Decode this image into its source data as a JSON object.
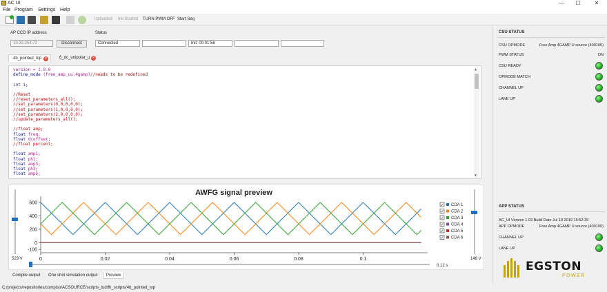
{
  "window": {
    "title": "AC UI",
    "minimize": "—",
    "maximize": "☐",
    "close": "✕"
  },
  "menu": [
    "File",
    "Program",
    "Settings",
    "Help"
  ],
  "toolbar": {
    "uploaded": "Uploaded",
    "init_started": "Init Started",
    "turn_pwm_off": "TURN PWM OFF",
    "start_seq": "Start Seq"
  },
  "ccd": {
    "label": "AP CCD IP address",
    "ip": "10.32.254.72",
    "disconnect": "Disconnect"
  },
  "status": {
    "label": "Status",
    "fields": [
      "Connected",
      "",
      "Init: 00:01:58",
      "",
      ""
    ]
  },
  "tabs": [
    "4b_pointed_top",
    "6_dc_unipolar_u"
  ],
  "code": [
    [
      {
        "t": "version = 1.0.0",
        "c": "id"
      }
    ],
    [
      {
        "t": "define_mode ",
        "c": "plain"
      },
      {
        "t": "(free_amp_uu.4gamp)",
        "c": "id"
      },
      {
        "t": "//needs to be redefined",
        "c": "cm"
      }
    ],
    [],
    [
      {
        "t": "int i;",
        "c": "plain"
      }
    ],
    [],
    [
      {
        "t": "//Reset",
        "c": "cm"
      }
    ],
    [
      {
        "t": "//reset_parameters_all();",
        "c": "cm"
      }
    ],
    [
      {
        "t": "//set_parameters(0,0,0,0,0);",
        "c": "cm"
      }
    ],
    [
      {
        "t": "//set_parameters(1,0,0,0,0);",
        "c": "cm"
      }
    ],
    [
      {
        "t": "//set_parameters(2,0,0,0,0);",
        "c": "cm"
      }
    ],
    [
      {
        "t": "//update_parameters_all();",
        "c": "cm"
      }
    ],
    [],
    [
      {
        "t": "//float amp;",
        "c": "cm"
      }
    ],
    [
      {
        "t": "float ",
        "c": "plain"
      },
      {
        "t": "freq;",
        "c": "id"
      }
    ],
    [
      {
        "t": "float ",
        "c": "plain"
      },
      {
        "t": "dcoffset;",
        "c": "id"
      }
    ],
    [
      {
        "t": "//float percent;",
        "c": "cm"
      }
    ],
    [],
    [
      {
        "t": "float ",
        "c": "plain"
      },
      {
        "t": "amp1;",
        "c": "id"
      }
    ],
    [
      {
        "t": "float ",
        "c": "plain"
      },
      {
        "t": "ph1;",
        "c": "id"
      }
    ],
    [
      {
        "t": "float ",
        "c": "plain"
      },
      {
        "t": "amp3;",
        "c": "id"
      }
    ],
    [
      {
        "t": "float ",
        "c": "plain"
      },
      {
        "t": "ph3;",
        "c": "id"
      }
    ],
    [
      {
        "t": "float ",
        "c": "plain"
      },
      {
        "t": "amp5;",
        "c": "id"
      }
    ]
  ],
  "chart_data": {
    "type": "line",
    "title": "AWFG signal preview",
    "xlabel": "",
    "ylabel": "",
    "xlim": [
      0,
      0.12
    ],
    "ylim": [
      -150,
      650
    ],
    "x_ticks": [
      "0",
      "0.02",
      "0.04",
      "0.06",
      "0.08",
      "0.1"
    ],
    "x_tick_values": [
      0,
      0.02,
      0.04,
      0.06,
      0.08,
      0.1
    ],
    "y_ticks": [
      "600",
      "400",
      "200",
      "0",
      "-100"
    ],
    "y_tick_values": [
      600,
      400,
      200,
      0,
      -100
    ],
    "grid": false,
    "legend_position": "right",
    "series": [
      {
        "name": "CDA 1",
        "color": "#1f77b4",
        "checked": true,
        "kind": "triangle",
        "min": 120,
        "max": 600,
        "period": 0.02,
        "phase": 0.0
      },
      {
        "name": "CDA 2",
        "color": "#ff7f0e",
        "checked": true,
        "kind": "triangle",
        "min": 120,
        "max": 600,
        "period": 0.02,
        "phase": 0.00667
      },
      {
        "name": "CDA 3",
        "color": "#2ca02c",
        "checked": true,
        "kind": "triangle",
        "min": 120,
        "max": 600,
        "period": 0.02,
        "phase": 0.01333
      },
      {
        "name": "CDA 4",
        "color": "#7a4aa1",
        "checked": true,
        "kind": "flat",
        "value": 0
      },
      {
        "name": "CDA 5",
        "color": "#d62728",
        "checked": true,
        "kind": "flat",
        "value": 0
      },
      {
        "name": "CDA 6",
        "color": "#8c564b",
        "checked": true,
        "kind": "flat",
        "value": 0
      }
    ],
    "left_slider_label": "523 V",
    "right_slider_label": "148 V",
    "x_slider_label": "0.12 s"
  },
  "bottom_tabs": [
    "Compile output",
    "One shot simulation output",
    "Preview"
  ],
  "status_path": "C:/projects/repositories/compiso/ACSOURCE/scripts_tud/fh_scripts/4b_pointed_top",
  "csu": {
    "heading": "CSU STATUS",
    "opmode_label": "CSU OPMODE",
    "opmode_value": "Free Amp 4GAMP U source (400100)",
    "pwm_label": "PWM STATUS",
    "pwm_value": "ON",
    "leds": [
      "CSU READY",
      "OPMODE MATCH",
      "CHANNEL UP",
      "LANE UP"
    ]
  },
  "app": {
    "heading": "APP STATUS",
    "version": "AC_UI Version 1.03 Build Date Jul 18 2019 15:52:39",
    "opmode_label": "APP OPMODE",
    "opmode_value": "Free Amp 4GAMP U source (400100)",
    "leds": [
      "CHANNEL UP",
      "LANE UP"
    ]
  },
  "logo": {
    "name": "EGSTON",
    "sub": "POWER",
    "color": "#c8a000"
  }
}
